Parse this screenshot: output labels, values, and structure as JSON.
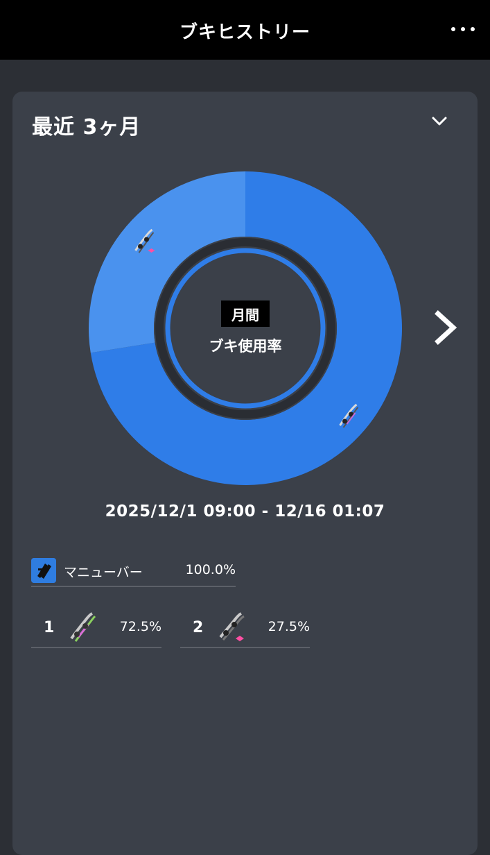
{
  "header": {
    "title": "ブキヒストリー",
    "menu_icon": "more-dots-icon"
  },
  "filter": {
    "period_label": "最近 3ヶ月",
    "dropdown_icon": "chevron-down-icon"
  },
  "chart_data": {
    "type": "pie",
    "categories": [
      "1",
      "2"
    ],
    "values": [
      72.5,
      27.5
    ],
    "colors": [
      "#2f7de8",
      "#4a92ee"
    ],
    "center_badge": "月間",
    "center_label": "ブキ使用率"
  },
  "navigation": {
    "next_icon": "chevron-right-icon"
  },
  "date_range": "2025/12/1 09:00 - 12/16 01:07",
  "sub_weapon": {
    "name": "マニューバー",
    "percent": "100.0%",
    "icon": "maneuver-class-icon"
  },
  "ranking": [
    {
      "rank": "1",
      "percent": "72.5%",
      "icon": "dualie-weapon-icon"
    },
    {
      "rank": "2",
      "percent": "27.5%",
      "icon": "dualie-pink-ribbon-weapon-icon"
    }
  ]
}
